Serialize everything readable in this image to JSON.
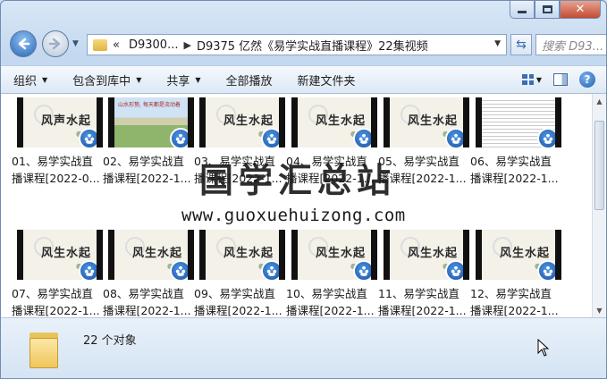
{
  "window": {
    "caption_buttons": [
      "minimize",
      "maximize",
      "close"
    ]
  },
  "address": {
    "chevrons": "«",
    "crumbs": [
      "D9300...",
      "D9375 亿然《易学实战直播课程》22集视频"
    ],
    "search_placeholder": "搜索 D93...",
    "refresh_icon": "refresh-arrows"
  },
  "toolbar": {
    "organize": "组织",
    "include_library": "包含到库中",
    "share": "共享",
    "play_all": "全部播放",
    "new_folder": "新建文件夹"
  },
  "files": [
    {
      "line1": "01、易学实战直",
      "line2": "播课程[2022-0...",
      "thumb_title": "风声水起",
      "style": "plain"
    },
    {
      "line1": "02、易学实战直",
      "line2": "播课程[2022-1...",
      "thumb_title": "山水形勢, 每天都是流动着",
      "style": "landscape"
    },
    {
      "line1": "03、易学实战直",
      "line2": "播课程[2022-1...",
      "thumb_title": "风生水起",
      "style": "plain"
    },
    {
      "line1": "04、易学实战直",
      "line2": "播课程[2022-1...",
      "thumb_title": "风生水起",
      "style": "plain"
    },
    {
      "line1": "05、易学实战直",
      "line2": "播课程[2022-1...",
      "thumb_title": "风生水起",
      "style": "plain"
    },
    {
      "line1": "06、易学实战直",
      "line2": "播课程[2022-1...",
      "thumb_title": "",
      "style": "doc"
    },
    {
      "line1": "07、易学实战直",
      "line2": "播课程[2022-1...",
      "thumb_title": "风生水起",
      "style": "plain"
    },
    {
      "line1": "08、易学实战直",
      "line2": "播课程[2022-1...",
      "thumb_title": "风生水起",
      "style": "plain"
    },
    {
      "line1": "09、易学实战直",
      "line2": "播课程[2022-1...",
      "thumb_title": "风生水起",
      "style": "plain"
    },
    {
      "line1": "10、易学实战直",
      "line2": "播课程[2022-1...",
      "thumb_title": "风生水起",
      "style": "plain"
    },
    {
      "line1": "11、易学实战直",
      "line2": "播课程[2022-1...",
      "thumb_title": "风生水起",
      "style": "plain"
    },
    {
      "line1": "12、易学实战直",
      "line2": "播课程[2022-1...",
      "thumb_title": "风生水起",
      "style": "plain"
    }
  ],
  "watermark": {
    "cn": "国学汇总站",
    "url": "www.guoxuehuizong.com"
  },
  "details": {
    "count": "22 个对象"
  }
}
